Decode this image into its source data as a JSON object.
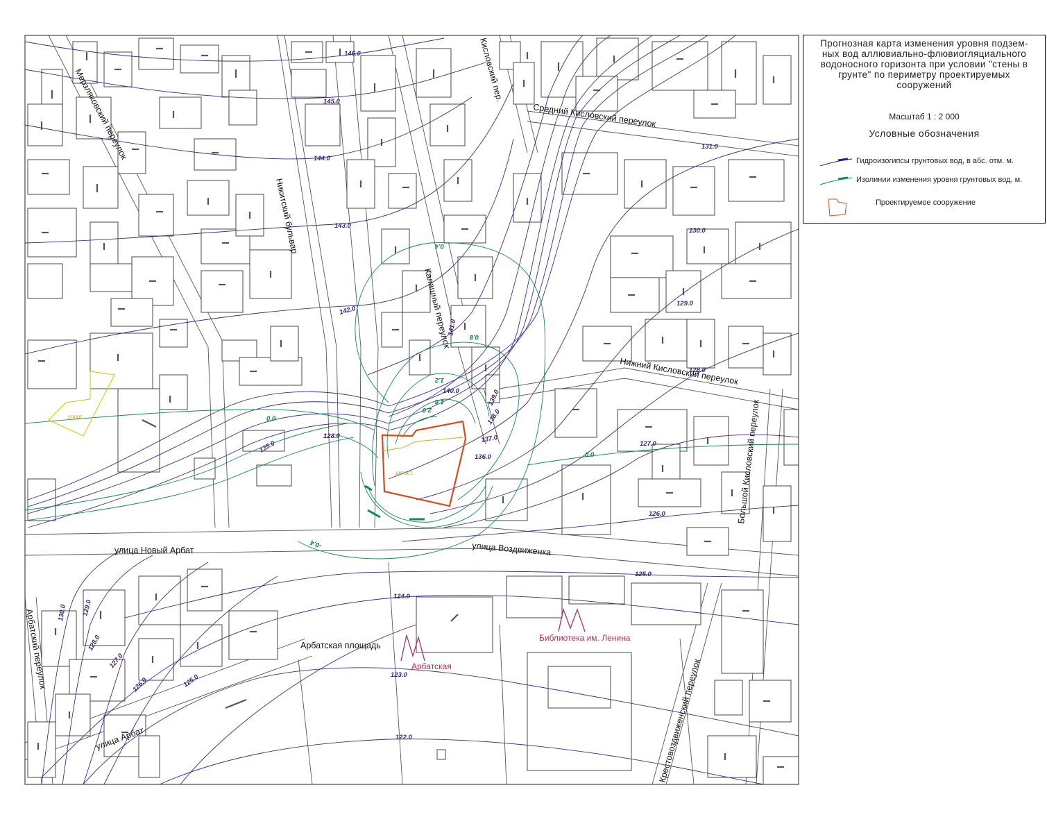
{
  "legend": {
    "title_lines": [
      "Прогнозная карта изменения уровня подзем-",
      "ных вод аллювиально-флювиогляциального",
      "водоносного горизонта при условии \"стены в",
      "грунте\" по периметру проектируемых",
      "сооружений"
    ],
    "scale": "Масштаб 1 : 2 000",
    "heading": "Условные обозначения",
    "items": [
      {
        "label": "Гидроизогипсы грунтовых вод, в абс. отм. м.",
        "color": "#2e1a8c"
      },
      {
        "label": "Изолинии изменения уровня грунтовых вод, м.",
        "color": "#0b8a55"
      },
      {
        "label": "Проектируемое сооружение",
        "color": "#d94a1a"
      }
    ]
  },
  "colors": {
    "hydroisohypse": "#3a2a9a",
    "change_isoline": "#0e8c4e",
    "projected_structure": "#d94a1a",
    "building": "#333333",
    "metro": "#b0305a",
    "sport_zone": "#c8c800"
  },
  "streets": [
    {
      "name": "Мерзляковский переулок"
    },
    {
      "name": "Никитский бульвар"
    },
    {
      "name": "Кисловский пер."
    },
    {
      "name": "Средний Кисловский переулок"
    },
    {
      "name": "Калашный переулок"
    },
    {
      "name": "Нижний Кисловский переулок"
    },
    {
      "name": "Большой Кисловский переулок"
    },
    {
      "name": "улица Новый Арбат"
    },
    {
      "name": "улица Воздвиженка"
    },
    {
      "name": "Арбатская площадь"
    },
    {
      "name": "Арбатский переулок"
    },
    {
      "name": "улица Арбат"
    },
    {
      "name": "Крестовоздвиженский переулок"
    }
  ],
  "metro": [
    {
      "name": "Арбатская"
    },
    {
      "name": "Библиотека им. Ленина"
    }
  ],
  "objects": [
    {
      "name": "спорт."
    },
    {
      "name": "автост."
    }
  ],
  "isohypse_labels": [
    "146.0",
    "145.0",
    "144.0",
    "143.0",
    "142.0",
    "141.0",
    "140.0",
    "139.0",
    "138.0",
    "137.0",
    "136.0",
    "135.0",
    "131.0",
    "130.0",
    "129.0",
    "128.0",
    "127.0",
    "126.0",
    "125.0",
    "124.0",
    "123.0",
    "122.0",
    "130.0",
    "129.0",
    "128.0",
    "127.0",
    "126.0",
    "125.0",
    "128.0"
  ],
  "change_labels": [
    "0.4",
    "0.8",
    "1.2",
    "1.6",
    "2.0",
    "0.0",
    "0.0",
    "-0.4"
  ]
}
